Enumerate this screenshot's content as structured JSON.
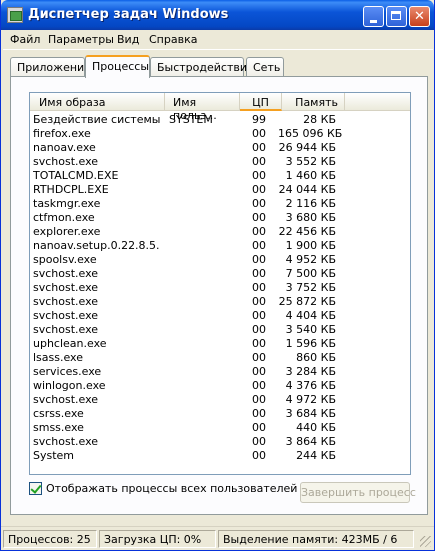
{
  "window": {
    "title": "Диспетчер задач Windows",
    "accent": "#0b55d8"
  },
  "menu": [
    "Файл",
    "Параметры",
    "Вид",
    "Справка"
  ],
  "tabs": [
    "Приложения",
    "Процессы",
    "Быстродействие",
    "Сеть"
  ],
  "active_tab": "Процессы",
  "columns": {
    "name": "Имя образа",
    "user": "Имя польз...",
    "cpu": "ЦП",
    "mem": "Память"
  },
  "processes": [
    {
      "name": "Бездействие системы",
      "user": "SYSTEM",
      "cpu": "99",
      "mem": "28 КБ"
    },
    {
      "name": "firefox.exe",
      "user": "",
      "cpu": "00",
      "mem": "165 096 КБ"
    },
    {
      "name": "nanoav.exe",
      "user": "",
      "cpu": "00",
      "mem": "26 944 КБ"
    },
    {
      "name": "svchost.exe",
      "user": "",
      "cpu": "00",
      "mem": "3 552 КБ"
    },
    {
      "name": "TOTALCMD.EXE",
      "user": "",
      "cpu": "00",
      "mem": "1 460 КБ"
    },
    {
      "name": "RTHDCPL.EXE",
      "user": "",
      "cpu": "00",
      "mem": "24 044 КБ"
    },
    {
      "name": "taskmgr.exe",
      "user": "",
      "cpu": "00",
      "mem": "2 116 КБ"
    },
    {
      "name": "ctfmon.exe",
      "user": "",
      "cpu": "00",
      "mem": "3 680 КБ"
    },
    {
      "name": "explorer.exe",
      "user": "",
      "cpu": "00",
      "mem": "22 456 КБ"
    },
    {
      "name": "nanoav.setup.0.22.8.5...",
      "user": "",
      "cpu": "00",
      "mem": "1 900 КБ"
    },
    {
      "name": "spoolsv.exe",
      "user": "",
      "cpu": "00",
      "mem": "4 952 КБ"
    },
    {
      "name": "svchost.exe",
      "user": "",
      "cpu": "00",
      "mem": "7 500 КБ"
    },
    {
      "name": "svchost.exe",
      "user": "",
      "cpu": "00",
      "mem": "3 752 КБ"
    },
    {
      "name": "svchost.exe",
      "user": "",
      "cpu": "00",
      "mem": "25 872 КБ"
    },
    {
      "name": "svchost.exe",
      "user": "",
      "cpu": "00",
      "mem": "4 404 КБ"
    },
    {
      "name": "svchost.exe",
      "user": "",
      "cpu": "00",
      "mem": "3 540 КБ"
    },
    {
      "name": "uphclean.exe",
      "user": "",
      "cpu": "00",
      "mem": "1 596 КБ"
    },
    {
      "name": "lsass.exe",
      "user": "",
      "cpu": "00",
      "mem": "860 КБ"
    },
    {
      "name": "services.exe",
      "user": "",
      "cpu": "00",
      "mem": "3 284 КБ"
    },
    {
      "name": "winlogon.exe",
      "user": "",
      "cpu": "00",
      "mem": "4 376 КБ"
    },
    {
      "name": "svchost.exe",
      "user": "",
      "cpu": "00",
      "mem": "4 972 КБ"
    },
    {
      "name": "csrss.exe",
      "user": "",
      "cpu": "00",
      "mem": "3 684 КБ"
    },
    {
      "name": "smss.exe",
      "user": "",
      "cpu": "00",
      "mem": "440 КБ"
    },
    {
      "name": "svchost.exe",
      "user": "",
      "cpu": "00",
      "mem": "3 864 КБ"
    },
    {
      "name": "System",
      "user": "",
      "cpu": "00",
      "mem": "244 КБ"
    }
  ],
  "show_all_users": {
    "label": "Отображать процессы всех пользователей",
    "checked": true
  },
  "end_process_button": "Завершить процесс",
  "status": {
    "processes": "Процессов: 25",
    "cpu_load": "Загрузка ЦП: 0%",
    "memory": "Выделение памяти: 423МБ / 6"
  }
}
